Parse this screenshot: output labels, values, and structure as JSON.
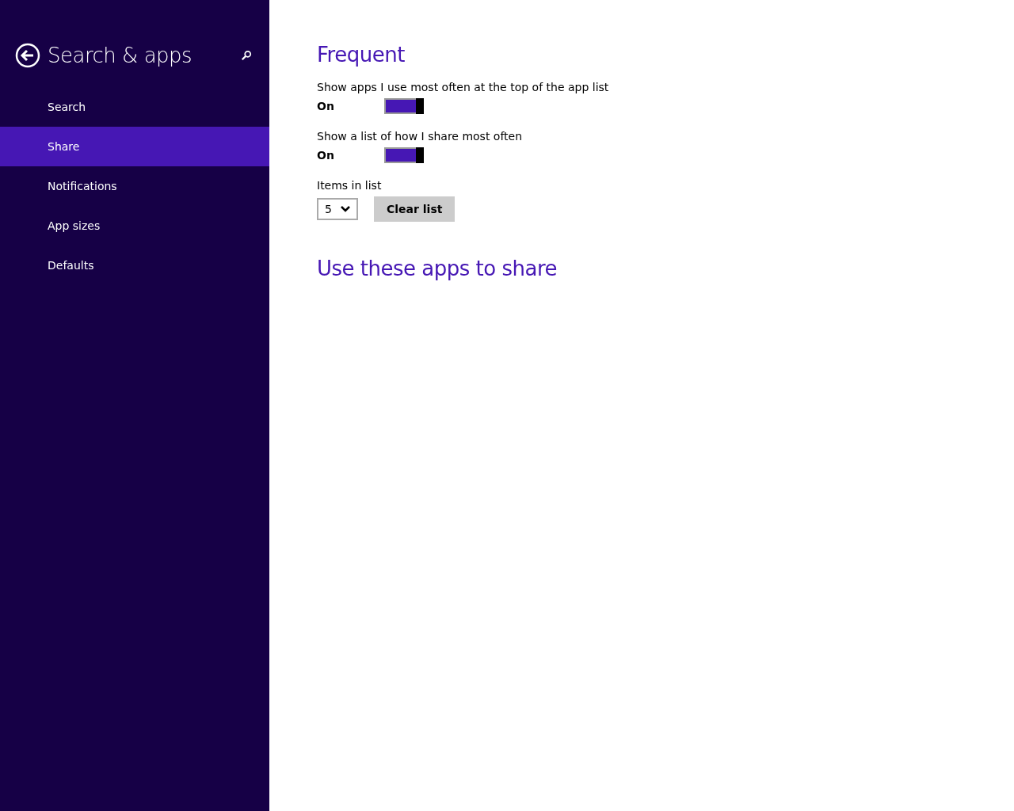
{
  "sidebar": {
    "title": "Search & apps",
    "items": [
      {
        "label": "Search",
        "selected": false
      },
      {
        "label": "Share",
        "selected": true
      },
      {
        "label": "Notifications",
        "selected": false
      },
      {
        "label": "App sizes",
        "selected": false
      },
      {
        "label": "Defaults",
        "selected": false
      }
    ]
  },
  "sections": [
    {
      "heading": "Frequent",
      "toggles": [
        {
          "label": "Show apps I use most often at the top of the app list",
          "state": "On",
          "on": true
        },
        {
          "label": "Show a list of how I share most often",
          "state": "On",
          "on": true
        }
      ],
      "items_label": "Items in list",
      "items_value": "5",
      "clear_button": "Clear list"
    },
    {
      "heading": "Use these apps to share"
    }
  ]
}
